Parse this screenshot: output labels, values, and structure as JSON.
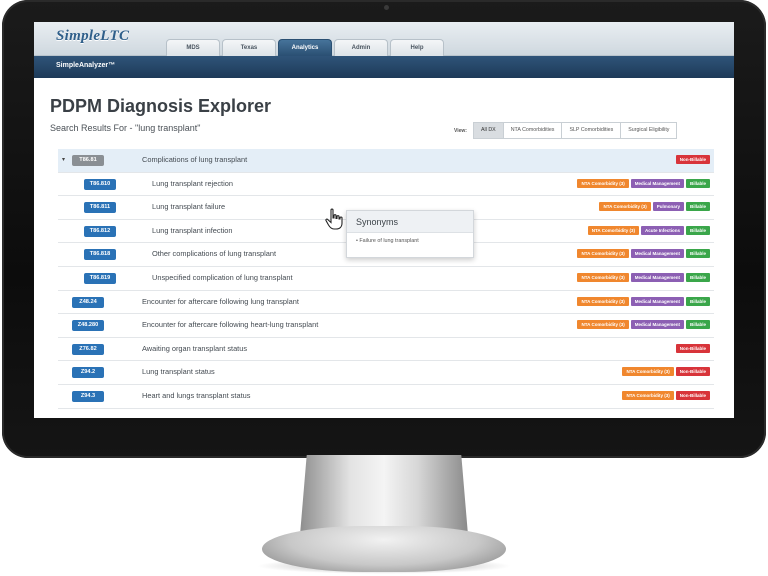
{
  "app": {
    "logo": "SimpleLTC",
    "subtitle": "SimpleAnalyzer™"
  },
  "tabs": [
    {
      "label": "MDS",
      "active": false
    },
    {
      "label": "Texas",
      "active": false
    },
    {
      "label": "Analytics",
      "active": true
    },
    {
      "label": "Admin",
      "active": false
    },
    {
      "label": "Help",
      "active": false
    }
  ],
  "page": {
    "title": "PDPM Diagnosis Explorer",
    "search_label": "Search Results For - \"lung transplant\""
  },
  "view": {
    "label": "View:",
    "options": [
      {
        "label": "All DX",
        "active": true
      },
      {
        "label": "NTA Comorbidities",
        "active": false
      },
      {
        "label": "SLP Comorbidities",
        "active": false
      },
      {
        "label": "Surgical Eligibility",
        "active": false
      }
    ]
  },
  "badge_colors": {
    "nta": "#f0872e",
    "medical": "#8c5fb3",
    "pulmonary": "#8c5fb3",
    "acute": "#8c5fb3",
    "billable": "#3aa64a",
    "non_billable": "#d8343a"
  },
  "results": [
    {
      "code": "T86.81",
      "desc": "Complications of lung transplant",
      "level": "parent",
      "badges": [
        {
          "text": "Non-Billable",
          "kind": "non_billable"
        }
      ]
    },
    {
      "code": "T86.810",
      "desc": "Lung transplant rejection",
      "level": "child",
      "badges": [
        {
          "text": "NTA Comorbidity (3)",
          "kind": "nta"
        },
        {
          "text": "Medical Management",
          "kind": "medical"
        },
        {
          "text": "Billable",
          "kind": "billable"
        }
      ]
    },
    {
      "code": "T86.811",
      "desc": "Lung transplant failure",
      "level": "child",
      "badges": [
        {
          "text": "NTA Comorbidity (3)",
          "kind": "nta"
        },
        {
          "text": "Pulmonary",
          "kind": "pulmonary"
        },
        {
          "text": "Billable",
          "kind": "billable"
        }
      ]
    },
    {
      "code": "T86.812",
      "desc": "Lung transplant infection",
      "level": "child",
      "badges": [
        {
          "text": "NTA Comorbidity (3)",
          "kind": "nta"
        },
        {
          "text": "Acute Infections",
          "kind": "acute"
        },
        {
          "text": "Billable",
          "kind": "billable"
        }
      ]
    },
    {
      "code": "T86.818",
      "desc": "Other complications of lung transplant",
      "level": "child",
      "badges": [
        {
          "text": "NTA Comorbidity (3)",
          "kind": "nta"
        },
        {
          "text": "Medical Management",
          "kind": "medical"
        },
        {
          "text": "Billable",
          "kind": "billable"
        }
      ]
    },
    {
      "code": "T86.819",
      "desc": "Unspecified complication of lung transplant",
      "level": "child",
      "badges": [
        {
          "text": "NTA Comorbidity (3)",
          "kind": "nta"
        },
        {
          "text": "Medical Management",
          "kind": "medical"
        },
        {
          "text": "Billable",
          "kind": "billable"
        }
      ]
    },
    {
      "code": "Z48.24",
      "desc": "Encounter for aftercare following lung transplant",
      "level": "top",
      "badges": [
        {
          "text": "NTA Comorbidity (3)",
          "kind": "nta"
        },
        {
          "text": "Medical Management",
          "kind": "medical"
        },
        {
          "text": "Billable",
          "kind": "billable"
        }
      ]
    },
    {
      "code": "Z48.280",
      "desc": "Encounter for aftercare following heart-lung transplant",
      "level": "top",
      "badges": [
        {
          "text": "NTA Comorbidity (3)",
          "kind": "nta"
        },
        {
          "text": "Medical Management",
          "kind": "medical"
        },
        {
          "text": "Billable",
          "kind": "billable"
        }
      ]
    },
    {
      "code": "Z76.82",
      "desc": "Awaiting organ transplant status",
      "level": "top",
      "badges": [
        {
          "text": "Non-Billable",
          "kind": "non_billable"
        }
      ]
    },
    {
      "code": "Z94.2",
      "desc": "Lung transplant status",
      "level": "top",
      "badges": [
        {
          "text": "NTA Comorbidity (3)",
          "kind": "nta"
        },
        {
          "text": "Non-Billable",
          "kind": "non_billable"
        }
      ]
    },
    {
      "code": "Z94.3",
      "desc": "Heart and lungs transplant status",
      "level": "top",
      "badges": [
        {
          "text": "NTA Comorbidity (3)",
          "kind": "nta"
        },
        {
          "text": "Non-Billable",
          "kind": "non_billable"
        }
      ]
    }
  ],
  "tooltip": {
    "title": "Synonyms",
    "items": [
      "Failure of lung transplant"
    ]
  }
}
